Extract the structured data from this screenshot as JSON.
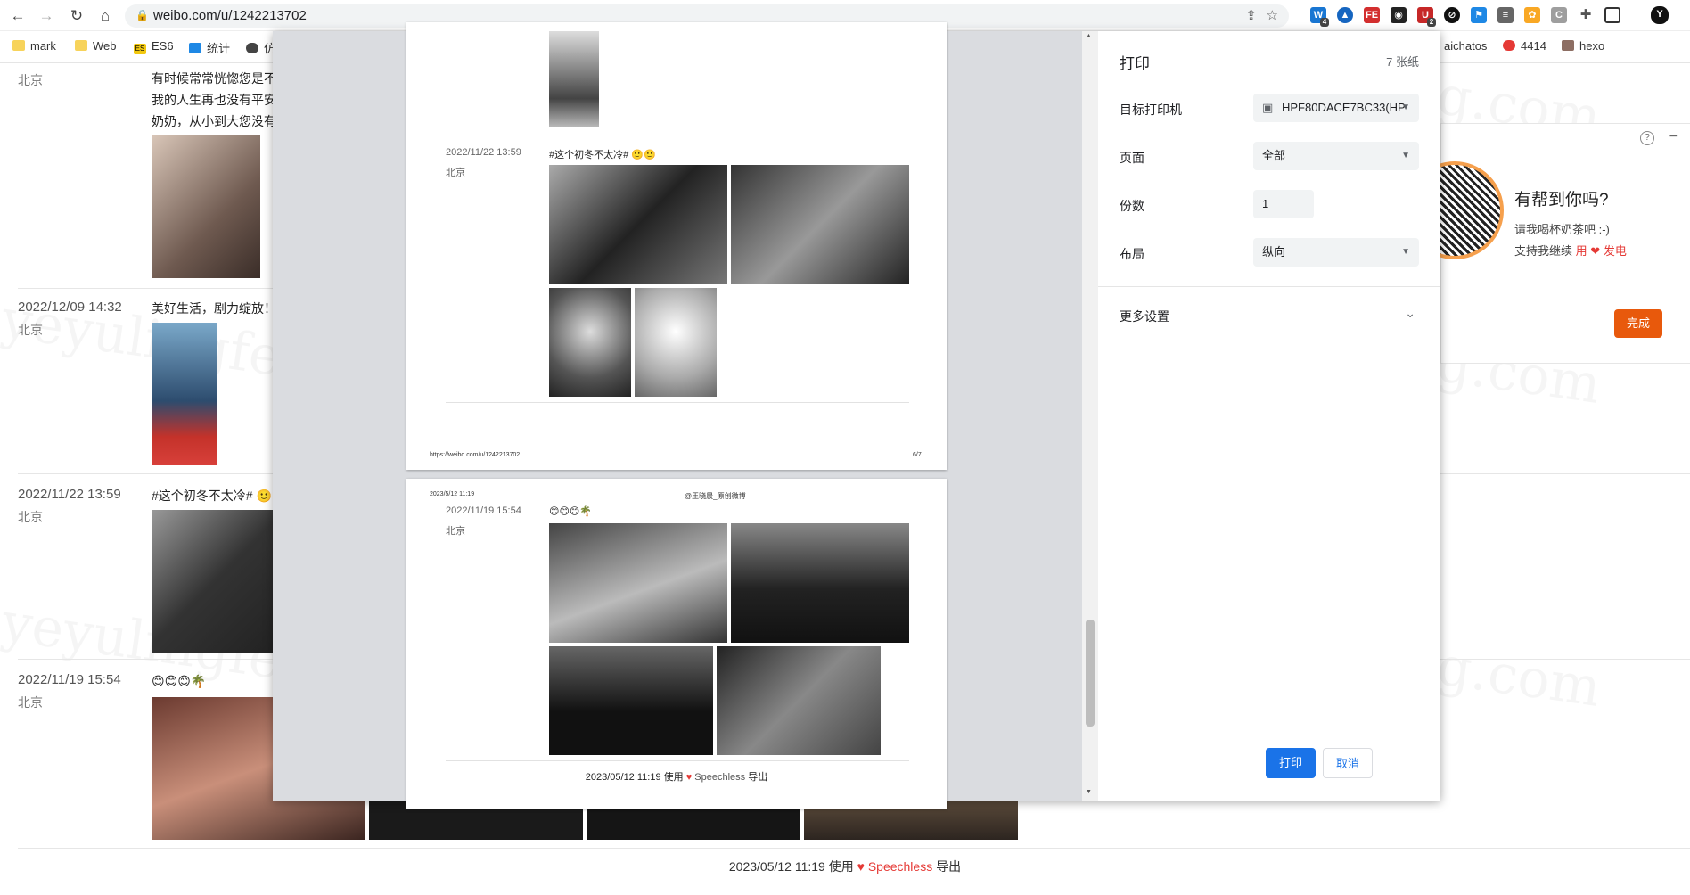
{
  "browser": {
    "url": "weibo.com/u/1242213702",
    "bookmarks": [
      {
        "label": "mark",
        "color": "#f7d35b"
      },
      {
        "label": "Web",
        "color": "#f7d35b"
      },
      {
        "label": "ES6",
        "color": "#f2c80f",
        "badge": "ES"
      },
      {
        "label": "统计",
        "color": "#1e88e5"
      },
      {
        "label": "仿",
        "color": "#444444"
      },
      {
        "label": "aichatos",
        "color": "#ffffff"
      },
      {
        "label": "4414",
        "color": "#e53935"
      },
      {
        "label": "hexo",
        "color": "#8d6e63"
      }
    ],
    "ext_badges": [
      "4",
      "2"
    ]
  },
  "background": {
    "posts": [
      {
        "date": "",
        "location": "北京",
        "text": "有时候常常恍惚您是不\n我的人生再也没有平安\n奶奶，从小到大您没有"
      },
      {
        "date": "2022/12/09 14:32",
        "location": "北京",
        "text": "美好生活，剧力绽放！"
      },
      {
        "date": "2022/11/22 13:59",
        "location": "北京",
        "text": "#这个初冬不太冷# 🙂"
      },
      {
        "date": "2022/11/19 15:54",
        "location": "北京",
        "text": "😊😊😊🌴"
      }
    ],
    "footer": {
      "prefix": "2023/05/12 11:19 使用",
      "heart": "♥",
      "brand": "Speechless",
      "suffix": "导出"
    }
  },
  "print_preview": {
    "page1": {
      "post": {
        "date": "2022/11/22 13:59",
        "location": "北京",
        "text": "#这个初冬不太冷# 🙂🙂"
      },
      "footer_url": "https://weibo.com/u/1242213702",
      "page_num": "6/7"
    },
    "page2": {
      "header_date": "2023/5/12 11:19",
      "header_title": "@王晓晨_原创微博",
      "post": {
        "date": "2022/11/19 15:54",
        "location": "北京",
        "text": "😊😊😊🌴"
      },
      "footer": {
        "prefix": "2023/05/12 11:19 使用",
        "heart": "♥",
        "brand": "Speechless",
        "suffix": "导出"
      }
    }
  },
  "print_panel": {
    "title": "打印",
    "sheets": "7 张纸",
    "destination_label": "目标打印机",
    "destination_value": "HPF80DACE7BC33(HP",
    "pages_label": "页面",
    "pages_value": "全部",
    "copies_label": "份数",
    "copies_value": "1",
    "layout_label": "布局",
    "layout_value": "纵向",
    "more_settings": "更多设置",
    "print_button": "打印",
    "cancel_button": "取消"
  },
  "help_card": {
    "title": "有帮到你吗?",
    "line1": "请我喝杯奶茶吧 :-)",
    "line2_prefix": "支持我继续",
    "line2_use": "用",
    "line2_heart": "❤",
    "line2_power": "发电",
    "done_button": "完成"
  },
  "colors": {
    "accent": "#1a73e8",
    "done": "#e8590c",
    "heart": "#e53935",
    "qr_ring": "#f6a04d"
  },
  "watermark": "yeyulingfeng.com"
}
